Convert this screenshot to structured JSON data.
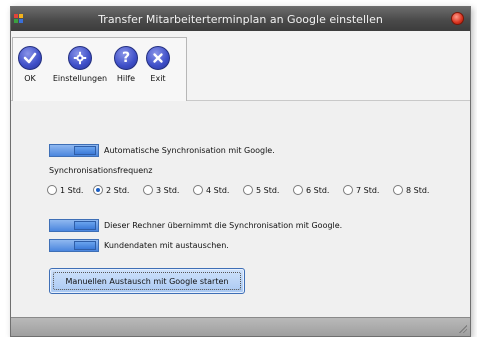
{
  "window": {
    "title": "Transfer Mitarbeiterterminplan an Google einstellen"
  },
  "toolbar": {
    "buttons": [
      {
        "label": "OK",
        "icon": "check-icon"
      },
      {
        "label": "Einstellungen",
        "icon": "gear-icon"
      },
      {
        "label": "Hilfe",
        "icon": "help-icon"
      },
      {
        "label": "Exit",
        "icon": "close-icon"
      }
    ]
  },
  "settings": {
    "auto_sync_label": "Automatische Synchronisation  mit Google.",
    "frequency_label": "Synchronisationsfrequenz",
    "frequency_options": [
      "1 Std.",
      "2 Std.",
      "3 Std.",
      "4 Std.",
      "5 Std.",
      "6 Std.",
      "7 Std.",
      "8 Std."
    ],
    "frequency_selected": "2 Std.",
    "this_computer_label": "Dieser Rechner übernimmt die Synchronisation mit Google.",
    "customer_data_label": "Kundendaten mit austauschen.",
    "manual_button_label": "Manuellen Austausch mit Google starten"
  },
  "colors": {
    "toggle": "#4b86de",
    "titlebar": "#4a4a4a",
    "accent": "#3e4fc8"
  }
}
